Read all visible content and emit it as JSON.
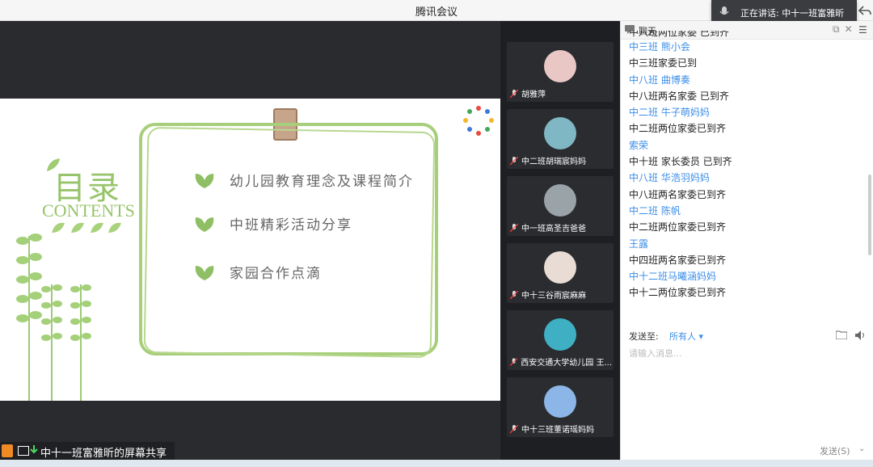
{
  "window": {
    "title": "腾讯会议"
  },
  "speaking": {
    "text": "正在讲话: 中十一班富雅昕"
  },
  "slide": {
    "heading_cn": "目录",
    "heading_en": "CONTENTS",
    "items": [
      "幼儿园教育理念及课程简介",
      "中班精彩活动分享",
      "家园合作点滴"
    ],
    "accent": "#97c46a"
  },
  "share_status": {
    "text": "中十一班富雅昕的屏幕共享"
  },
  "participants": [
    {
      "name": "胡雅萍",
      "avatar_color": "#e9c7c4"
    },
    {
      "name": "中二班胡瑞宸妈妈",
      "avatar_color": "#7fb7c4"
    },
    {
      "name": "中一班高圣吉爸爸",
      "avatar_color": "#9aa3a8"
    },
    {
      "name": "中十三谷雨宸麻麻",
      "avatar_color": "#e8dcd4"
    },
    {
      "name": "西安交通大学幼儿园  王...",
      "avatar_color": "#3fb0c4"
    },
    {
      "name": "中十三班董诺瑶妈妈",
      "avatar_color": "#8db6e8"
    }
  ],
  "chat": {
    "title": "聊天",
    "messages": [
      {
        "kind": "partial",
        "text": "中八班两位家委 已到齐"
      },
      {
        "kind": "name",
        "text": "中三班  熊小会"
      },
      {
        "kind": "body",
        "text": "中三班家委已到"
      },
      {
        "kind": "name",
        "text": "中八班 曲博奏"
      },
      {
        "kind": "body",
        "text": "中八班两名家委 已到齐"
      },
      {
        "kind": "name",
        "text": "中二班  牛子萌妈妈"
      },
      {
        "kind": "body",
        "text": "中二班两位家委已到齐"
      },
      {
        "kind": "name",
        "text": "索荣"
      },
      {
        "kind": "body",
        "text": "中十班  家长委员  已到齐"
      },
      {
        "kind": "name",
        "text": "中八班 华浩羽妈妈"
      },
      {
        "kind": "body",
        "text": "中八班两名家委已到齐"
      },
      {
        "kind": "name",
        "text": "中二班 陈帆"
      },
      {
        "kind": "body",
        "text": "中二班两位家委已到齐"
      },
      {
        "kind": "name",
        "text": "王露"
      },
      {
        "kind": "body",
        "text": "中四班两名家委已到齐"
      },
      {
        "kind": "name",
        "text": "中十二班马曦涵妈妈"
      },
      {
        "kind": "body",
        "text": "中十二两位家委已到齐"
      }
    ],
    "send_to_label": "发送至:",
    "send_to_value": "所有人 ▾",
    "input_placeholder": "请输入消息...",
    "send_button": "发送(S)"
  }
}
